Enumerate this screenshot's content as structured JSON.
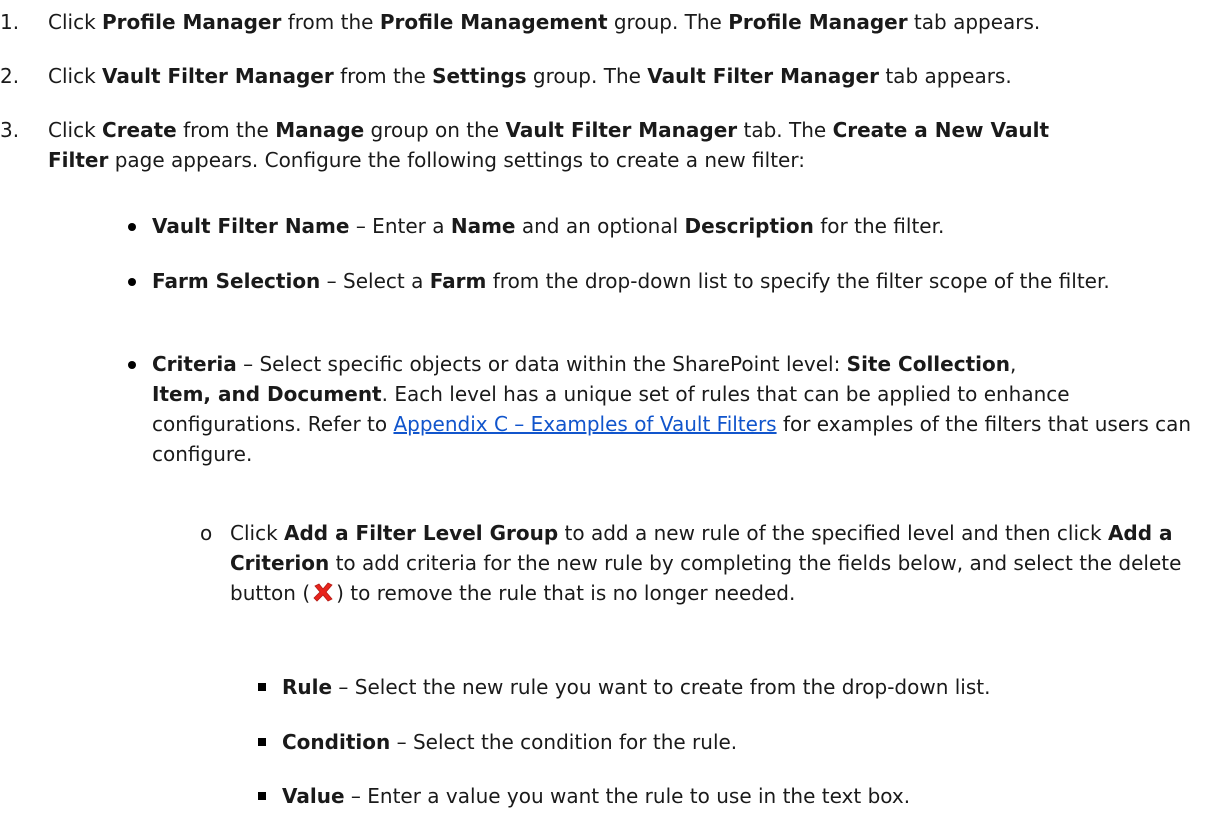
{
  "icons": {
    "delete_button": "red-x-delete-icon"
  },
  "colors": {
    "link": "#1155cc",
    "delete_icon": "#e8241c"
  },
  "steps": [
    {
      "num": "1.",
      "parts": [
        "Click ",
        "Profile Manager",
        " from the ",
        "Profile Management",
        " group. The ",
        "Profile Manager",
        " tab appears."
      ]
    },
    {
      "num": "2.",
      "parts": [
        "Click ",
        "Vault Filter Manager",
        " from the ",
        "Settings",
        " group. The ",
        "Vault Filter Manager",
        " tab appears."
      ]
    },
    {
      "num": "3.",
      "parts": [
        "Click ",
        "Create",
        " from the ",
        "Manage",
        " group on the ",
        "Vault Filter Manager",
        " tab. The ",
        "Create a New Vault",
        "Filter",
        " page appears. Configure the following settings to create a new filter:"
      ]
    }
  ],
  "bullets": [
    {
      "parts": [
        "Vault Filter Name",
        " – Enter a ",
        "Name",
        " and an optional ",
        "Description",
        " for the filter."
      ]
    },
    {
      "parts": [
        "Farm Selection",
        " – Select a ",
        "Farm",
        " from the drop-down list to specify the filter scope of the filter."
      ]
    },
    {
      "parts": [
        "Criteria",
        " – Select specific objects or data within the SharePoint level: ",
        "Site Collection",
        ",",
        "Item",
        ", ",
        "and Document",
        ". Each level has a unique set of rules that can be applied to enhance configurations. Refer to ",
        "Appendix C – Examples of Vault Filters",
        " for examples of the filters that users can configure."
      ]
    }
  ],
  "sub_item": {
    "marker": "o",
    "parts": [
      "Click ",
      "Add a Filter Level Group",
      " to add a new rule of the specified level and then click ",
      "Add a Criterion",
      " to add criteria for the new rule by completing the fields below, and select the delete button (",
      ") to remove the rule that is no longer needed."
    ]
  },
  "fields": [
    {
      "name": "Rule",
      "desc": " – Select the new rule you want to create from the drop-down list."
    },
    {
      "name": "Condition",
      "desc": " – Select the condition for the rule."
    },
    {
      "name": "Value",
      "desc": " – Enter a value you want the rule to use in the text box."
    }
  ]
}
